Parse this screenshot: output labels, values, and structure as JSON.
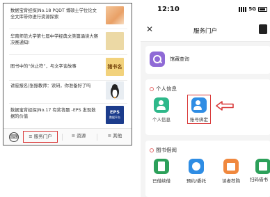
{
  "left_panel": {
    "articles": [
      {
        "text": "数据宝背经探|No.18 PQDT 博硕士学位论文全文库带你进行资源探索"
      },
      {
        "text": "华南师范大学第七届中学经典文美篇诵读大赛决赛通知!"
      },
      {
        "text": "图书中的“休止符”，与文字谈故事",
        "thumb_text": "猪书名"
      },
      {
        "text": "讲座报名|张振教师：读研，你准备好了吗"
      },
      {
        "text": "数据宝背经探|No.17 有奖答题 -EPS 发现数据的价值",
        "thumb_text": "EPS",
        "thumb_sub": "数据平台"
      }
    ],
    "bottom_bar": {
      "keyboard_icon": "keyboard-icon",
      "tabs": [
        {
          "label": "≡ 服务门户"
        },
        {
          "label": "≡ 资源"
        },
        {
          "label": "≡ 其他"
        }
      ]
    }
  },
  "right_screen": {
    "status_bar": {
      "time": "12:10",
      "network": "5G"
    },
    "nav": {
      "close": "✕",
      "title": "服务门户"
    },
    "query": {
      "label": "馆藏查询"
    },
    "personal": {
      "title": "个人信息",
      "items": [
        {
          "label": "个人信息"
        },
        {
          "label": "账号绑定"
        }
      ]
    },
    "borrow": {
      "title": "图书借阅",
      "items": [
        {
          "label": "已借续借"
        },
        {
          "label": "预约/委托"
        },
        {
          "label": "读者荐购"
        },
        {
          "label": "扫码借书"
        }
      ]
    },
    "colors": {
      "highlight": "#d93a3a",
      "accent_green": "#2eb88a",
      "accent_blue": "#2f8de4"
    }
  }
}
